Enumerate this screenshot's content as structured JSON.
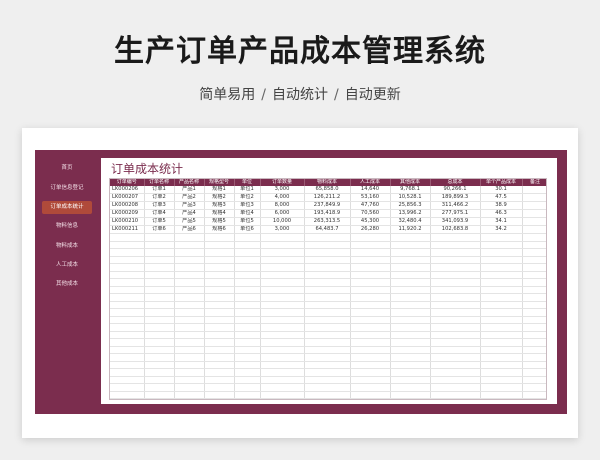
{
  "header": {
    "title": "生产订单产品成本管理系统",
    "subtitle_parts": [
      "简单易用",
      "自动统计",
      "自动更新"
    ],
    "separator": "/"
  },
  "sidebar": {
    "items": [
      {
        "label": "首页",
        "active": false
      },
      {
        "label": "订单信息登记",
        "active": false
      },
      {
        "label": "订单成本统计",
        "active": true
      },
      {
        "label": "物料信息",
        "active": false
      },
      {
        "label": "物料成本",
        "active": false
      },
      {
        "label": "人工成本",
        "active": false
      },
      {
        "label": "其他成本",
        "active": false
      }
    ]
  },
  "panel": {
    "title": "订单成本统计"
  },
  "table": {
    "columns": [
      "订单编号",
      "订单名称",
      "产品名称",
      "规格型号",
      "单位",
      "订单数量",
      "物料成本",
      "人工成本",
      "其他成本",
      "总成本",
      "单个产品成本",
      "备注"
    ],
    "rows": [
      [
        "LK000206",
        "订单1",
        "产品1",
        "规格1",
        "单位1",
        "3,000",
        "65,858.0",
        "14,640",
        "9,768.1",
        "90,266.1",
        "30.1",
        ""
      ],
      [
        "LK000207",
        "订单2",
        "产品2",
        "规格2",
        "单位2",
        "4,000",
        "126,211.2",
        "53,160",
        "10,528.1",
        "189,899.3",
        "47.5",
        ""
      ],
      [
        "LK000208",
        "订单3",
        "产品3",
        "规格3",
        "单位3",
        "8,000",
        "237,849.9",
        "47,760",
        "25,856.3",
        "311,466.2",
        "38.9",
        ""
      ],
      [
        "LK000209",
        "订单4",
        "产品4",
        "规格4",
        "单位4",
        "6,000",
        "193,418.9",
        "70,560",
        "13,996.2",
        "277,975.1",
        "46.3",
        ""
      ],
      [
        "LK000210",
        "订单5",
        "产品5",
        "规格5",
        "单位5",
        "10,000",
        "263,313.5",
        "45,300",
        "32,480.4",
        "341,093.9",
        "34.1",
        ""
      ],
      [
        "LK000211",
        "订单6",
        "产品6",
        "规格6",
        "单位6",
        "3,000",
        "64,483.7",
        "26,280",
        "11,920.2",
        "102,683.8",
        "34.2",
        ""
      ]
    ],
    "empty_row_count": 22
  },
  "colors": {
    "accent": "#7b2d4e",
    "active_nav": "#b04a3a"
  }
}
